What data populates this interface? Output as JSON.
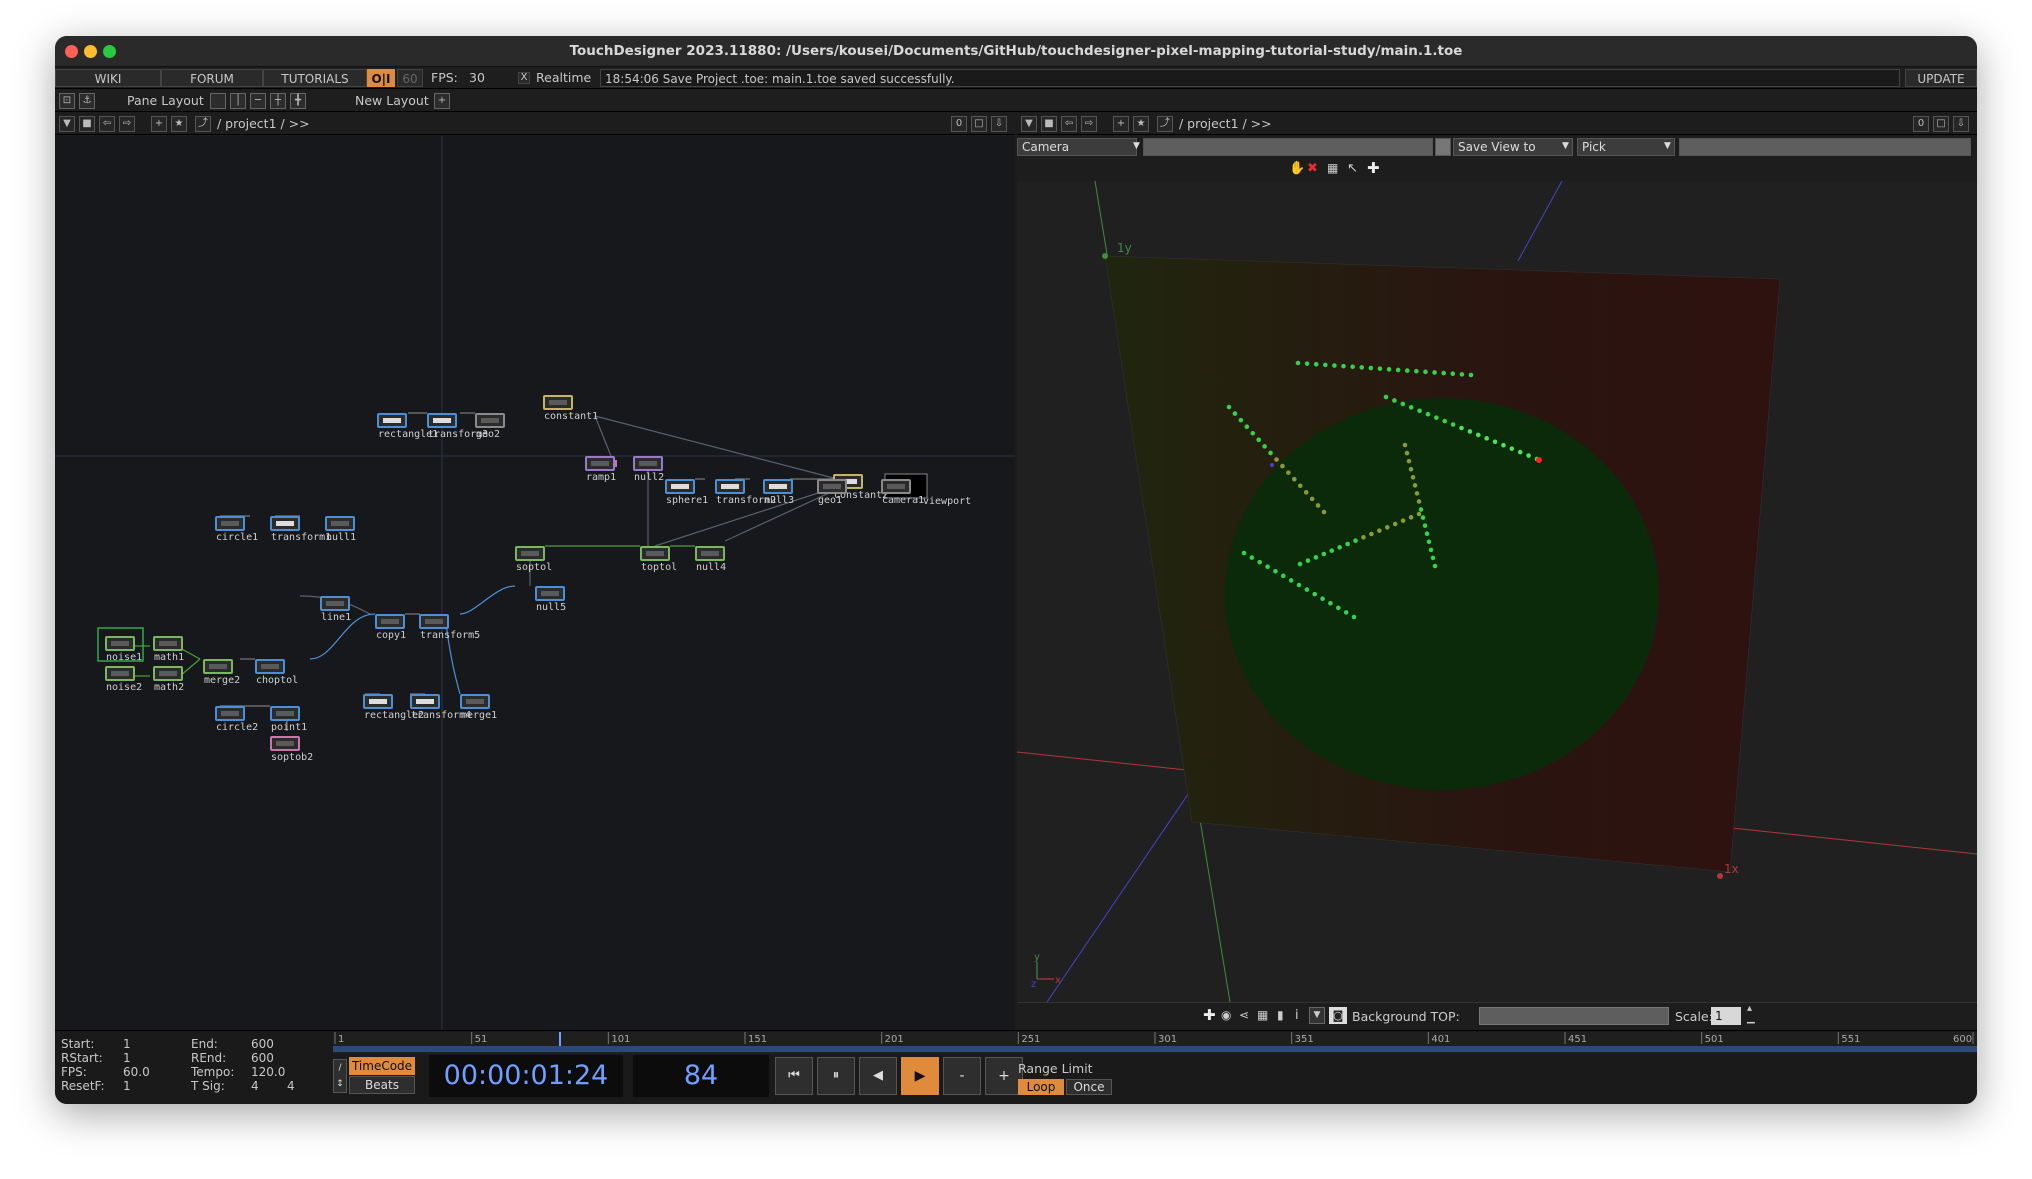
{
  "window": {
    "title": "TouchDesigner 2023.11880: /Users/kousei/Documents/GitHub/touchdesigner-pixel-mapping-tutorial-study/main.1.toe",
    "traffic_lights": {
      "close": "#ff5f57",
      "minimize": "#febc2e",
      "zoom": "#28c840"
    }
  },
  "menubar": {
    "wiki": "WIKI",
    "forum": "FORUM",
    "tutorials": "TUTORIALS",
    "oi": "O|I",
    "fps_60": "60",
    "fps_label": "FPS:",
    "fps_value": "30",
    "realtime_check": "X",
    "realtime": "Realtime",
    "status": "18:54:06 Save Project .toe: main.1.toe saved successfully.",
    "update": "UPDATE"
  },
  "layoutbar": {
    "pane_layout": "Pane Layout",
    "new_layout": "New Layout"
  },
  "left_pane": {
    "path": "/ project1 / >>",
    "counter": "0"
  },
  "right_pane": {
    "path": "/ project1 / >>",
    "counter": "0",
    "camera": "Camera",
    "save_view": "Save View to",
    "pick": "Pick",
    "axis_1y": "1y",
    "axis_1x": "1x",
    "axis_small_y": "y",
    "axis_small_x": "x",
    "axis_small_z": "z",
    "background_top_label": "Background TOP:",
    "scale_label": "Scale:",
    "scale_value": "1"
  },
  "nodes": [
    {
      "id": "constant1",
      "label": "constant1",
      "color": "#c8b460",
      "fill": "dark"
    },
    {
      "id": "rectangle1",
      "label": "rectangle1",
      "color": "#4b8fd6",
      "fill": "light"
    },
    {
      "id": "transform3",
      "label": "transform3",
      "color": "#4b8fd6",
      "fill": "light"
    },
    {
      "id": "geo2",
      "label": "geo2",
      "color": "#8a8a8a",
      "fill": "dark"
    },
    {
      "id": "ramp1",
      "label": "ramp1",
      "color": "#9a7ac8",
      "fill": "dark"
    },
    {
      "id": "null2",
      "label": "null2",
      "color": "#9a7ac8",
      "fill": "dark"
    },
    {
      "id": "constant2",
      "label": "constant2",
      "color": "#c8b460",
      "fill": "light"
    },
    {
      "id": "sphere1",
      "label": "sphere1",
      "color": "#4b8fd6",
      "fill": "light"
    },
    {
      "id": "transform2",
      "label": "transform2",
      "color": "#4b8fd6",
      "fill": "light"
    },
    {
      "id": "null3",
      "label": "null3",
      "color": "#4b8fd6",
      "fill": "light"
    },
    {
      "id": "geo1",
      "label": "geo1",
      "color": "#8a8a8a",
      "fill": "dark"
    },
    {
      "id": "camera1",
      "label": "camera1",
      "color": "#8a8a8a",
      "fill": "dark"
    },
    {
      "id": "viewport",
      "label": "viewport",
      "color": "#8a8a8a",
      "fill": "dark"
    },
    {
      "id": "circle1",
      "label": "circle1",
      "color": "#4b8fd6",
      "fill": "dark"
    },
    {
      "id": "transform1",
      "label": "transform1",
      "color": "#4b8fd6",
      "fill": "light"
    },
    {
      "id": "null1",
      "label": "null1",
      "color": "#4b8fd6",
      "fill": "dark"
    },
    {
      "id": "soptol",
      "label": "soptol",
      "color": "#7ab860",
      "fill": "dark"
    },
    {
      "id": "toptol",
      "label": "toptol",
      "color": "#7ab860",
      "fill": "dark"
    },
    {
      "id": "null4",
      "label": "null4",
      "color": "#7ab860",
      "fill": "dark"
    },
    {
      "id": "line1",
      "label": "line1",
      "color": "#4b8fd6",
      "fill": "dark"
    },
    {
      "id": "null5",
      "label": "null5",
      "color": "#4b8fd6",
      "fill": "dark"
    },
    {
      "id": "copy1",
      "label": "copy1",
      "color": "#4b8fd6",
      "fill": "dark"
    },
    {
      "id": "transform5",
      "label": "transform5",
      "color": "#4b8fd6",
      "fill": "dark"
    },
    {
      "id": "noise1",
      "label": "noise1",
      "color": "#7ab860",
      "fill": "dark"
    },
    {
      "id": "math1",
      "label": "math1",
      "color": "#7ab860",
      "fill": "dark"
    },
    {
      "id": "merge2",
      "label": "merge2",
      "color": "#7ab860",
      "fill": "dark"
    },
    {
      "id": "choptol",
      "label": "choptol",
      "color": "#4b8fd6",
      "fill": "dark"
    },
    {
      "id": "noise2",
      "label": "noise2",
      "color": "#7ab860",
      "fill": "dark"
    },
    {
      "id": "math2",
      "label": "math2",
      "color": "#7ab860",
      "fill": "dark"
    },
    {
      "id": "rectangle2",
      "label": "rectangle2",
      "color": "#4b8fd6",
      "fill": "light"
    },
    {
      "id": "transform4",
      "label": "transform4",
      "color": "#4b8fd6",
      "fill": "light"
    },
    {
      "id": "merge1",
      "label": "merge1",
      "color": "#4b8fd6",
      "fill": "dark"
    },
    {
      "id": "circle2",
      "label": "circle2",
      "color": "#4b8fd6",
      "fill": "dark"
    },
    {
      "id": "point1",
      "label": "point1",
      "color": "#4b8fd6",
      "fill": "dark"
    },
    {
      "id": "soptob2",
      "label": "soptob2",
      "color": "#c878a8",
      "fill": "dark"
    }
  ],
  "timeline": {
    "start_label": "Start:",
    "start": "1",
    "end_label": "End:",
    "end": "600",
    "rstart_label": "RStart:",
    "rstart": "1",
    "rend_label": "REnd:",
    "rend": "600",
    "fps_label": "FPS:",
    "fps": "60.0",
    "tempo_label": "Tempo:",
    "tempo": "120.0",
    "resetf_label": "ResetF:",
    "resetf": "1",
    "tsig_label": "T Sig:",
    "tsig_a": "4",
    "tsig_b": "4",
    "ticks": [
      "1",
      "51",
      "101",
      "151",
      "201",
      "251",
      "301",
      "351",
      "401",
      "451",
      "501",
      "551",
      "600"
    ],
    "timecode_btn": "TimeCode",
    "beats_btn": "Beats",
    "timecode": "00:00:01:24",
    "frame": "84",
    "minus": "-",
    "plus": "+",
    "range_limit": "Range Limit",
    "loop": "Loop",
    "once": "Once",
    "accent": "#e08a3c",
    "timecode_color": "#6fa0ff"
  }
}
